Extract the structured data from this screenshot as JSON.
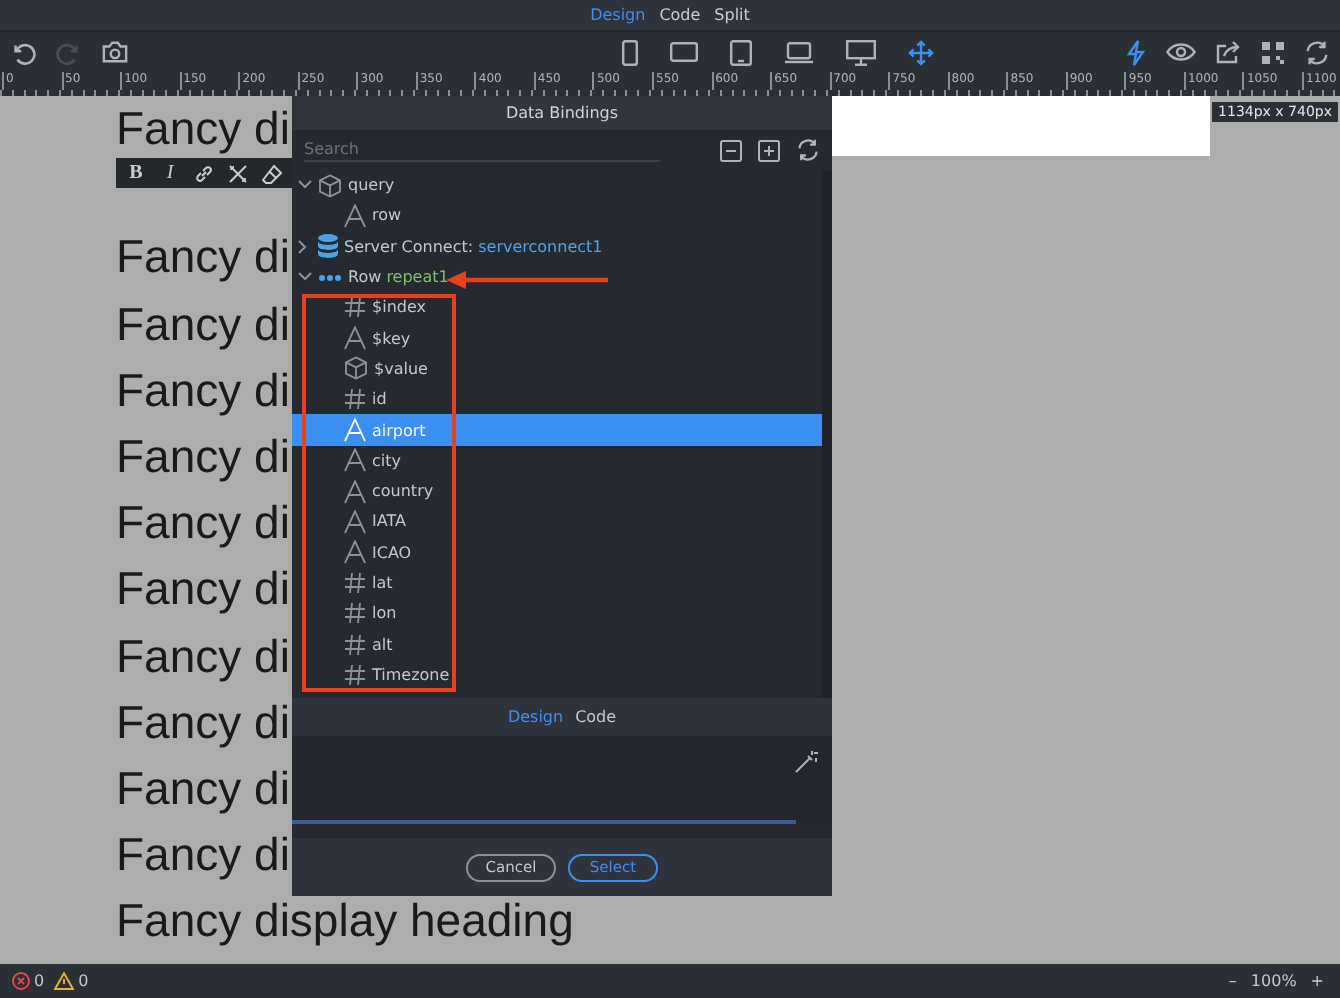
{
  "mode_tabs": [
    {
      "label": "Design",
      "selected": true
    },
    {
      "label": "Code",
      "selected": false
    },
    {
      "label": "Split",
      "selected": false
    }
  ],
  "toolbar": {
    "left": [
      {
        "kind": "undo",
        "disabled": false
      },
      {
        "kind": "redo",
        "disabled": true
      },
      {
        "kind": "camera",
        "disabled": false
      }
    ],
    "devices": [
      {
        "kind": "phone",
        "selected": false
      },
      {
        "kind": "tablet-landscape",
        "selected": false
      },
      {
        "kind": "tablet",
        "selected": false
      },
      {
        "kind": "laptop",
        "selected": false
      },
      {
        "kind": "desktop",
        "selected": false
      },
      {
        "kind": "move",
        "selected": true
      }
    ],
    "right": [
      {
        "kind": "lightning",
        "selected": true
      },
      {
        "kind": "eye",
        "selected": false
      },
      {
        "kind": "share",
        "selected": false
      },
      {
        "kind": "qr",
        "selected": false
      },
      {
        "kind": "refresh",
        "selected": false
      }
    ]
  },
  "ruler": [
    "0",
    "50",
    "100",
    "150",
    "200",
    "250",
    "300",
    "350",
    "400",
    "450",
    "500",
    "550",
    "600",
    "650",
    "700",
    "750",
    "800",
    "850",
    "900",
    "950",
    "1000",
    "1050",
    "1100"
  ],
  "canvas": {
    "headings": [
      "Fancy di",
      "Fancy di",
      "Fancy di",
      "Fancy di",
      "Fancy di",
      "Fancy di",
      "Fancy di",
      "Fancy di",
      "Fancy di",
      "Fancy di",
      "Fancy di",
      "Fancy display heading"
    ],
    "size_badge": "1134px x 740px",
    "format_toolbar": [
      {
        "kind": "bold",
        "label": "B"
      },
      {
        "kind": "italic",
        "label": "I"
      },
      {
        "kind": "link"
      },
      {
        "kind": "unlink"
      },
      {
        "kind": "eraser"
      }
    ]
  },
  "dialog": {
    "title": "Data Bindings",
    "search": {
      "placeholder": "Search"
    },
    "tree": [
      {
        "kind": "object",
        "label": "query",
        "expanded": true,
        "selected": false,
        "children": [
          {
            "kind": "text",
            "label": "row",
            "selected": false
          }
        ]
      },
      {
        "kind": "database",
        "label": "Server Connect:",
        "name": "serverconnect1",
        "expanded": false,
        "selected": false
      },
      {
        "kind": "repeat",
        "label": "Row",
        "name": "repeat1",
        "expanded": true,
        "selected": false,
        "children": [
          {
            "kind": "number",
            "label": "$index",
            "selected": false
          },
          {
            "kind": "text",
            "label": "$key",
            "selected": false
          },
          {
            "kind": "object",
            "label": "$value",
            "selected": false
          },
          {
            "kind": "number",
            "label": "id",
            "selected": false
          },
          {
            "kind": "text",
            "label": "airport",
            "selected": true
          },
          {
            "kind": "text",
            "label": "city",
            "selected": false
          },
          {
            "kind": "text",
            "label": "country",
            "selected": false
          },
          {
            "kind": "text",
            "label": "IATA",
            "selected": false
          },
          {
            "kind": "text",
            "label": "ICAO",
            "selected": false
          },
          {
            "kind": "number",
            "label": "lat",
            "selected": false
          },
          {
            "kind": "number",
            "label": "lon",
            "selected": false
          },
          {
            "kind": "number",
            "label": "alt",
            "selected": false
          },
          {
            "kind": "number",
            "label": "Timezone",
            "selected": false
          }
        ]
      }
    ],
    "editor_tabs": [
      {
        "label": "Design",
        "selected": true
      },
      {
        "label": "Code",
        "selected": false
      }
    ],
    "buttons": [
      {
        "kind": "secondary",
        "label": "Cancel"
      },
      {
        "kind": "primary",
        "label": "Select"
      }
    ]
  },
  "status_bar": {
    "errors": "0",
    "warnings": "0",
    "zoom_out": "–",
    "zoom": "100%",
    "zoom_in": "+"
  }
}
